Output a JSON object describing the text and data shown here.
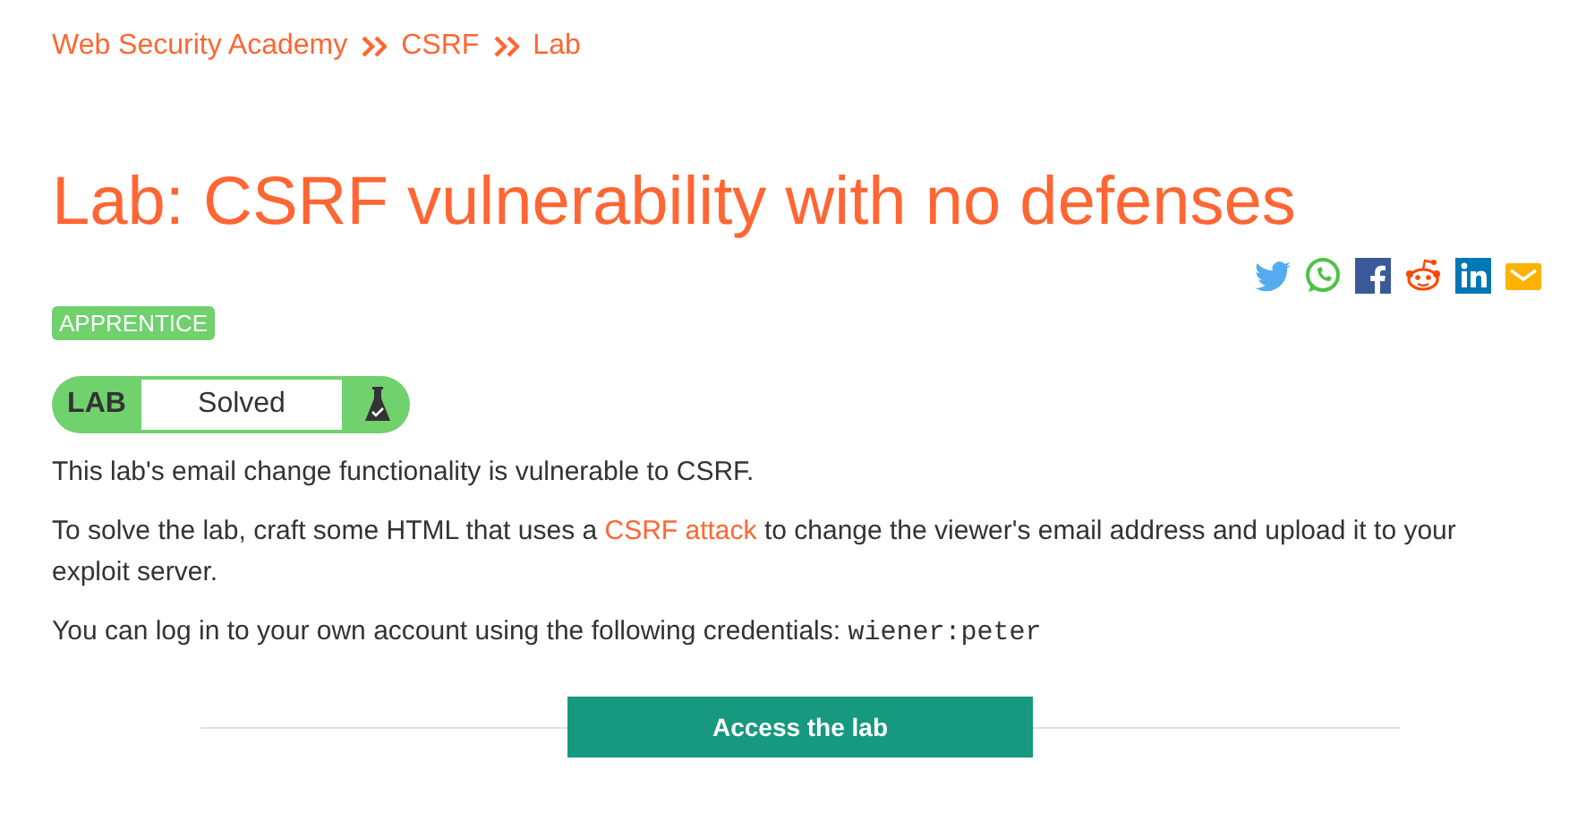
{
  "breadcrumbs": [
    {
      "label": "Web Security Academy"
    },
    {
      "label": "CSRF"
    },
    {
      "label": "Lab"
    }
  ],
  "title": "Lab: CSRF vulnerability with no defenses",
  "share_icons": [
    {
      "kind": "twitter"
    },
    {
      "kind": "whatsapp"
    },
    {
      "kind": "facebook"
    },
    {
      "kind": "reddit"
    },
    {
      "kind": "linkedin"
    },
    {
      "kind": "email"
    }
  ],
  "level_badge": "APPRENTICE",
  "lab_status": {
    "label": "LAB",
    "status": "Solved"
  },
  "description": [
    {
      "kind": "text",
      "text": "This lab's email change functionality is vulnerable to CSRF."
    },
    {
      "kind": "link",
      "before": "To solve the lab, craft some HTML that uses a",
      "link": "CSRF attack",
      "after": "to change the viewer's email address and upload it to your exploit server."
    },
    {
      "kind": "code",
      "before": "You can log in to your own account using the following credentials:",
      "code": "wiener:peter"
    }
  ],
  "access_button": "Access the lab"
}
